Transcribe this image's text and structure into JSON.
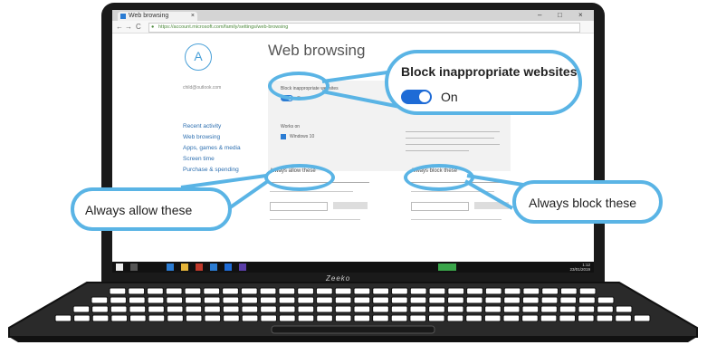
{
  "browser": {
    "tab_title": "Web browsing",
    "tab_close": "×",
    "win_min": "–",
    "win_max": "□",
    "win_close": "×",
    "back": "←",
    "forward": "→",
    "reload": "C",
    "url_secure": "https://account.microsoft.com/family/settings/web-browsing"
  },
  "sidebar": {
    "avatar_glyph": "A",
    "child_name": "child@outlook.com",
    "links": [
      "Recent activity",
      "Web browsing",
      "Apps, games & media",
      "Screen time",
      "Purchase & spending"
    ]
  },
  "main": {
    "title": "Web browsing",
    "block_setting_label": "Block inappropriate websites",
    "block_setting_state": "On",
    "works_with_label": "Works on",
    "windows_label": "Windows 10",
    "allow_section": "Always allow these",
    "block_section": "Always block these"
  },
  "callouts": {
    "block_heading": "Block inappropriate websites",
    "block_state": "On",
    "allow_label": "Always allow these",
    "block_label": "Always block these"
  },
  "laptop": {
    "brand": "Zeeko"
  },
  "taskbar": {
    "time": "1:12",
    "date": "23/01/2019"
  },
  "colors": {
    "callout_border": "#5ab4e5",
    "toggle_on": "#1e6bd6",
    "link": "#2d6fb0"
  }
}
